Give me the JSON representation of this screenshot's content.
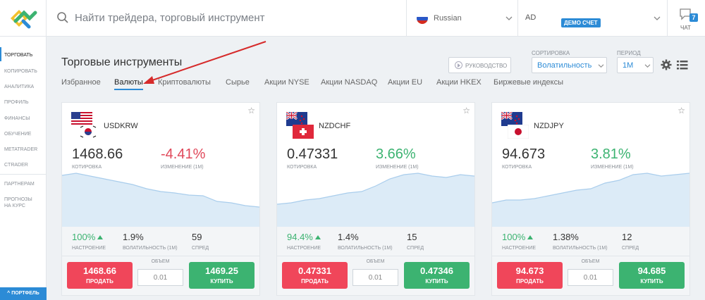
{
  "search": {
    "placeholder": "Найти трейдера, торговый инструмент"
  },
  "language": {
    "label": "Russian"
  },
  "account": {
    "initials": "AD",
    "badge": "ДЕМО СЧЕТ"
  },
  "chat": {
    "label": "ЧАТ",
    "count": "7"
  },
  "sidebar": {
    "items": [
      "ТОРГОВАТЬ",
      "КОПИРОВАТЬ",
      "АНАЛИТИКА",
      "ПРОФИЛЬ",
      "ФИНАНСЫ",
      "ОБУЧЕНИЕ",
      "METATRADER",
      "CTRADER"
    ],
    "extra": [
      "ПАРТНЕРАМ",
      "ПРОГНОЗЫ",
      "НА КУРС"
    ],
    "portfolio": "^ ПОРТФЕЛЬ"
  },
  "page": {
    "title": "Торговые инструменты",
    "guide": "РУКОВОДСТВО",
    "sort_label": "СОРТИРОВКА",
    "sort_value": "Волатильность",
    "period_label": "ПЕРИОД",
    "period_value": "1M"
  },
  "tabs": [
    "Избранное",
    "Валюты",
    "Криптовалюты",
    "Сырье",
    "Акции NYSE",
    "Акции NASDAQ",
    "Акции EU",
    "Акции HKEX",
    "Биржевые индексы"
  ],
  "labels": {
    "quote": "КОТИРОВКА",
    "change": "ИЗМЕНЕНИЕ (1М)",
    "sentiment": "НАСТРОЕНИЕ",
    "volatility": "ВОЛАТИЛЬНОСТЬ (1М)",
    "spread": "СПРЕД",
    "volume": "ОБЪЕМ",
    "sell": "ПРОДАТЬ",
    "buy": "КУПИТЬ"
  },
  "cards": [
    {
      "pair": "USDKRW",
      "quote": "1468.66",
      "change": "-4.41%",
      "sentiment": "100%",
      "volatility": "1.9%",
      "spread": "59",
      "volume": "0.01",
      "sell": "1468.66",
      "buy": "1469.25",
      "change_color": "#e0485a"
    },
    {
      "pair": "NZDCHF",
      "quote": "0.47331",
      "change": "3.66%",
      "sentiment": "94.4%",
      "volatility": "1.4%",
      "spread": "15",
      "volume": "0.01",
      "sell": "0.47331",
      "buy": "0.47346",
      "change_color": "#3cb371"
    },
    {
      "pair": "NZDJPY",
      "quote": "94.673",
      "change": "3.81%",
      "sentiment": "100%",
      "volatility": "1.38%",
      "spread": "12",
      "volume": "0.01",
      "sell": "94.673",
      "buy": "94.685",
      "change_color": "#3cb371"
    }
  ],
  "colors": {
    "accent": "#2c8bd6",
    "sell": "#f0465a",
    "buy": "#3cb371",
    "chart_fill": "#dcebf7",
    "chart_line": "#a9cdec"
  }
}
